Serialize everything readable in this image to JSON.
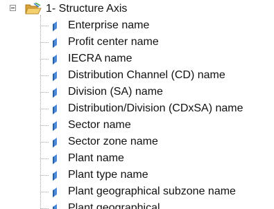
{
  "tree": {
    "root": {
      "label": "1- Structure Axis",
      "expander_icon": "collapse-minus-icon",
      "icon": "open-folder-icon"
    },
    "items": [
      {
        "label": "Enterprise name",
        "icon": "field-icon"
      },
      {
        "label": "Profit center name",
        "icon": "field-icon"
      },
      {
        "label": "IECRA name",
        "icon": "field-icon"
      },
      {
        "label": "Distribution Channel (CD) name",
        "icon": "field-icon"
      },
      {
        "label": "Division (SA) name",
        "icon": "field-icon"
      },
      {
        "label": "Distribution/Division (CDxSA) name",
        "icon": "field-icon"
      },
      {
        "label": "Sector name",
        "icon": "field-icon"
      },
      {
        "label": "Sector zone name",
        "icon": "field-icon"
      },
      {
        "label": "Plant name",
        "icon": "field-icon"
      },
      {
        "label": "Plant type name",
        "icon": "field-icon"
      },
      {
        "label": "Plant geographical subzone name",
        "icon": "field-icon"
      },
      {
        "label": "Plant geographical",
        "icon": "field-icon"
      }
    ],
    "colors": {
      "folder": "#e8b64a",
      "field_icon": "#3a78c8",
      "connector": "#a0a0a0"
    }
  }
}
